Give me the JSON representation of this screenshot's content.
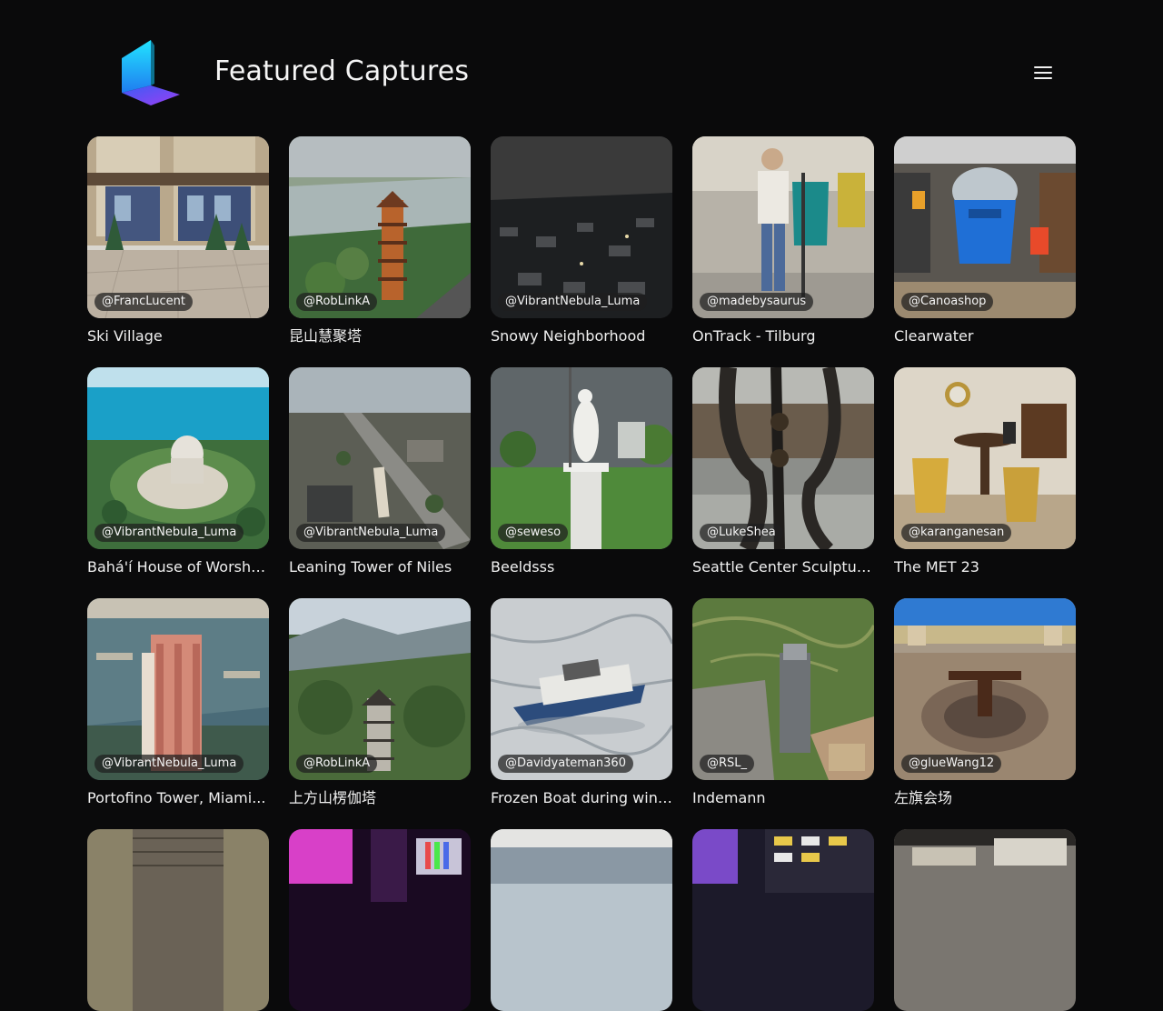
{
  "header": {
    "title": "Featured Captures",
    "logo_icon": "luma-logo-icon",
    "menu_icon": "hamburger-menu-icon"
  },
  "captures": [
    {
      "title": "Ski Village",
      "author": "@FrancLucent",
      "scene": "village"
    },
    {
      "title": "昆山慧聚塔",
      "author": "@RobLinkA",
      "scene": "pagoda-river"
    },
    {
      "title": "Snowy Neighborhood",
      "author": "@VibrantNebula_Luma",
      "scene": "snowy-city"
    },
    {
      "title": "OnTrack - Tilburg",
      "author": "@madebysaurus",
      "scene": "store-person"
    },
    {
      "title": "Clearwater",
      "author": "@Canoashop",
      "scene": "shop-vest"
    },
    {
      "title": "Bahá'í House of Worship ...",
      "author": "@VibrantNebula_Luma",
      "scene": "temple-lake"
    },
    {
      "title": "Leaning Tower of Niles",
      "author": "@VibrantNebula_Luma",
      "scene": "aerial-town"
    },
    {
      "title": "Beeldsss",
      "author": "@seweso",
      "scene": "statue"
    },
    {
      "title": "Seattle Center Sculpture...",
      "author": "@LukeShea",
      "scene": "sculpture"
    },
    {
      "title": "The MET 23",
      "author": "@karanganesan",
      "scene": "museum-room"
    },
    {
      "title": "Portofino Tower, Miami...",
      "author": "@VibrantNebula_Luma",
      "scene": "tower-harbor"
    },
    {
      "title": "上方山楞伽塔",
      "author": "@RobLinkA",
      "scene": "pagoda-mountain"
    },
    {
      "title": "Frozen Boat during winter",
      "author": "@Davidyateman360",
      "scene": "frozen-boat"
    },
    {
      "title": "Indemann",
      "author": "@RSL_",
      "scene": "indemann"
    },
    {
      "title": "左旗会场",
      "author": "@glueWang12",
      "scene": "plaza"
    },
    {
      "title": "",
      "author": "",
      "scene": "tower-wood"
    },
    {
      "title": "",
      "author": "",
      "scene": "neon-stage"
    },
    {
      "title": "",
      "author": "",
      "scene": "sky-water"
    },
    {
      "title": "",
      "author": "",
      "scene": "press-room"
    },
    {
      "title": "",
      "author": "",
      "scene": "workshop"
    }
  ]
}
